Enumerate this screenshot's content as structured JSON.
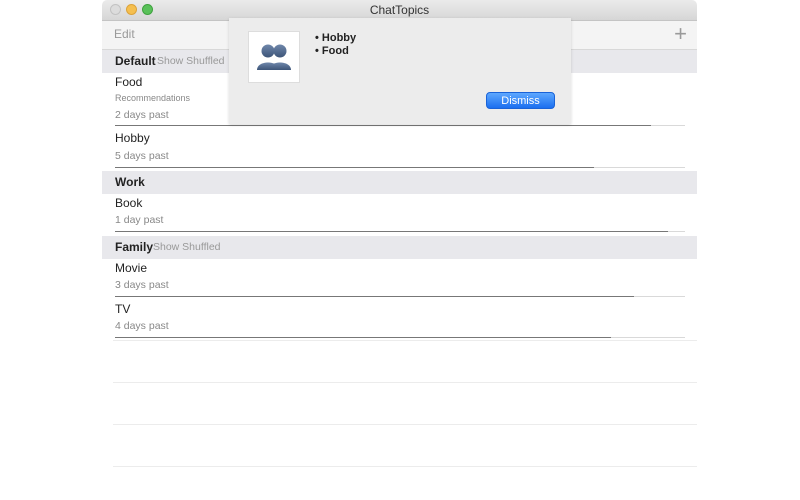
{
  "window": {
    "title": "ChatTopics"
  },
  "toolbar": {
    "edit_label": "Edit",
    "add_label": "+"
  },
  "sections": [
    {
      "name": "Default",
      "shuffle_label": "Show Shuffled",
      "rows": [
        {
          "topic": "Food",
          "subtitle": "Recommendations",
          "ago": "2 days past",
          "progress": 0.94
        },
        {
          "topic": "Hobby",
          "subtitle": "",
          "ago": "5 days past",
          "progress": 0.84
        }
      ]
    },
    {
      "name": "Work",
      "shuffle_label": "",
      "rows": [
        {
          "topic": "Book",
          "subtitle": "",
          "ago": "1 day past",
          "progress": 0.97
        }
      ]
    },
    {
      "name": "Family",
      "shuffle_label": "Show Shuffled",
      "rows": [
        {
          "topic": "Movie",
          "subtitle": "",
          "ago": "3 days past",
          "progress": 0.91
        },
        {
          "topic": "TV",
          "subtitle": "",
          "ago": "4 days past",
          "progress": 0.87
        }
      ]
    }
  ],
  "popover": {
    "items": [
      "• Hobby",
      "• Food"
    ],
    "dismiss_label": "Dismiss"
  },
  "colors": {
    "accent": "#1b6ff0",
    "section_bg": "#e8e8ec"
  },
  "icons": {
    "popover_image": "people-icon",
    "add": "plus-icon"
  }
}
